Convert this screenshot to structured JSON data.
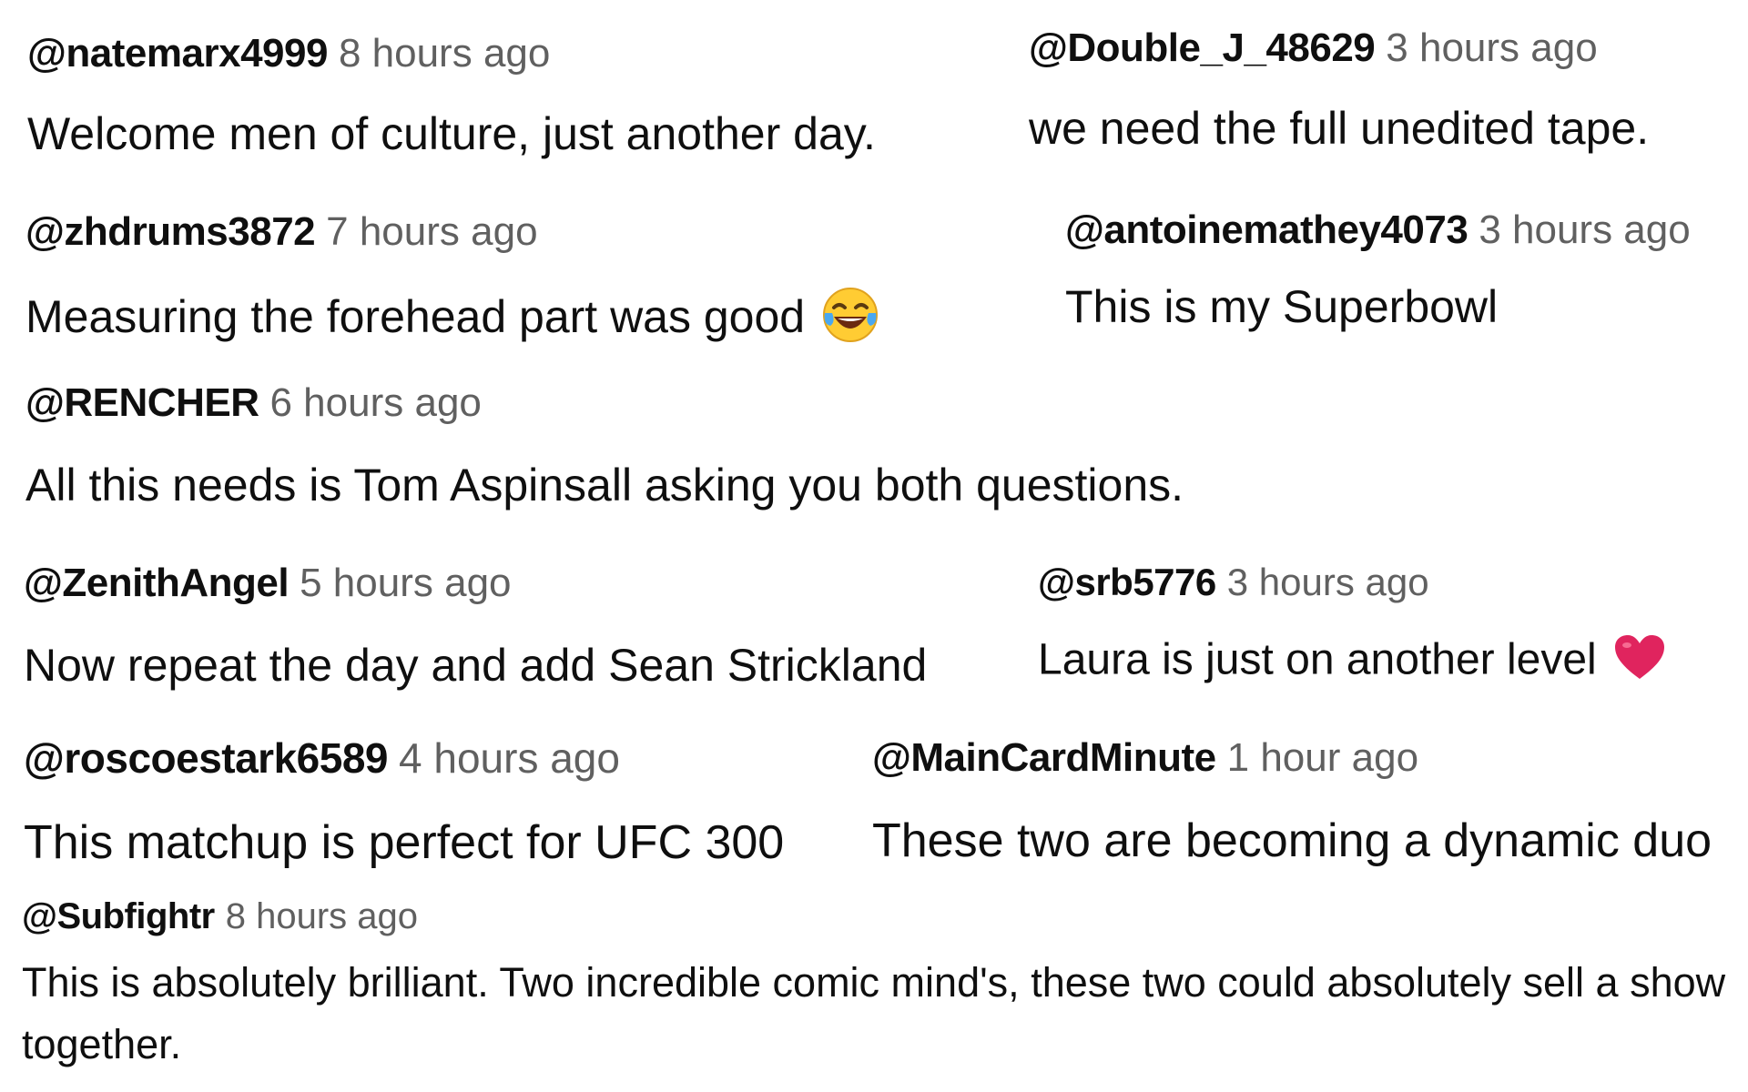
{
  "comments": [
    {
      "handle": "@natemarx4999",
      "time": "8 hours ago",
      "text": "Welcome men of culture, just another day."
    },
    {
      "handle": "@Double_J_48629",
      "time": "3 hours ago",
      "text": "we need the full unedited tape."
    },
    {
      "handle": "@zhdrums3872",
      "time": "7 hours ago",
      "text": "Measuring the forehead part was good",
      "emoji": "laughing-tears-emoji"
    },
    {
      "handle": "@antoinemathey4073",
      "time": "3 hours ago",
      "text": "This is my Superbowl"
    },
    {
      "handle": "@RENCHER",
      "time": "6 hours ago",
      "text": "All this needs is Tom Aspinsall asking you both questions."
    },
    {
      "handle": "@ZenithAngel",
      "time": "5 hours ago",
      "text": "Now repeat the day and add Sean Strickland"
    },
    {
      "handle": "@srb5776",
      "time": "3 hours ago",
      "text": "Laura is just on another level",
      "emoji": "red-heart-emoji"
    },
    {
      "handle": "@roscoestark6589",
      "time": "4 hours ago",
      "text": "This matchup is perfect for UFC 300"
    },
    {
      "handle": "@MainCardMinute",
      "time": "1 hour ago",
      "text": "These two are becoming a dynamic duo"
    },
    {
      "handle": "@Subfightr",
      "time": "8 hours ago",
      "text": "This is absolutely brilliant. Two incredible comic mind's, these two could absolutely sell a show together."
    }
  ],
  "colors": {
    "text": "#0f0f0f",
    "timestamp": "#606060",
    "heart": "#e0245e",
    "emoji_face": "#ffcc33"
  }
}
